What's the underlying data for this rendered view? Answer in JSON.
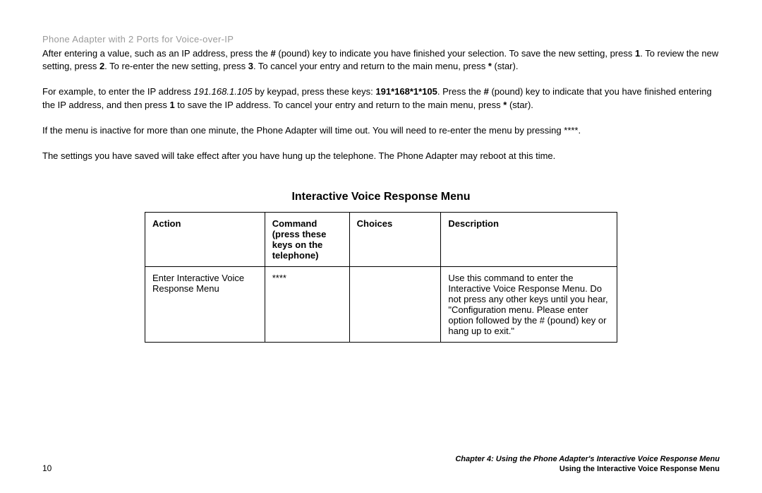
{
  "header": {
    "title": "Phone Adapter with 2 Ports for Voice-over-IP"
  },
  "paragraphs": {
    "p1_pre": "After entering a value, such as an IP address, press the ",
    "p1_b1": "#",
    "p1_mid1": " (pound) key to indicate you have finished your selection. To save the new setting, press ",
    "p1_b2": "1",
    "p1_mid2": ". To review the new setting, press ",
    "p1_b3": "2",
    "p1_mid3": ". To re-enter the new setting, press ",
    "p1_b4": "3",
    "p1_mid4": ". To cancel your entry and return to the main menu, press ",
    "p1_b5": "*",
    "p1_end": " (star).",
    "p2_pre": "For example, to enter the IP address ",
    "p2_i1": "191.168.1.105",
    "p2_mid1": " by keypad, press these keys: ",
    "p2_b1": "191*168*1*105",
    "p2_mid2": ". Press the ",
    "p2_b2": "#",
    "p2_mid3": " (pound) key to indicate that you have finished entering the IP address, and then press ",
    "p2_b3": "1",
    "p2_mid4": " to save the IP address. To cancel your entry and return to the main menu, press ",
    "p2_b4": "*",
    "p2_end": " (star).",
    "p3": "If the menu is inactive for more than one minute, the Phone Adapter will time out. You will need to re-enter the menu by pressing ****.",
    "p4": "The settings you have saved will take effect after you have hung up the telephone. The Phone Adapter may reboot at this time."
  },
  "section": {
    "heading": "Interactive Voice Response Menu"
  },
  "table": {
    "headers": {
      "action": "Action",
      "command": "Command (press these keys on the telephone)",
      "choices": "Choices",
      "description": "Description"
    },
    "rows": [
      {
        "action": "Enter Interactive Voice Response Menu",
        "command": "****",
        "choices": "",
        "description": "Use this command to enter the Interactive Voice Response Menu. Do not press any other keys until you hear, \"Configuration menu. Please enter option followed by the # (pound) key or hang up to exit.\""
      }
    ]
  },
  "footer": {
    "page_number": "10",
    "chapter": "Chapter 4: Using the Phone Adapter's Interactive Voice Response Menu",
    "subtitle": "Using the Interactive Voice Response Menu"
  }
}
